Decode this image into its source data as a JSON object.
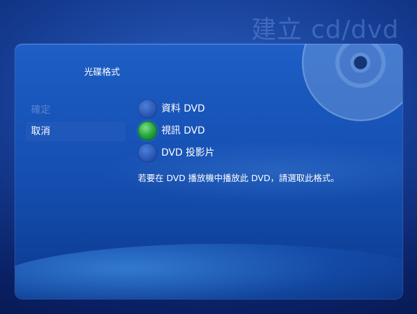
{
  "header": {
    "title": "建立 cd/dvd"
  },
  "panel": {
    "title": "光碟格式"
  },
  "menu": {
    "items": [
      {
        "label": "確定",
        "state": "disabled"
      },
      {
        "label": "取消",
        "state": "active"
      }
    ]
  },
  "options": [
    {
      "label": "資料 DVD",
      "selected": false
    },
    {
      "label": "視訊 DVD",
      "selected": true
    },
    {
      "label": "DVD 投影片",
      "selected": false
    }
  ],
  "description": "若要在 DVD 播放機中播放此 DVD，請選取此格式。",
  "colors": {
    "background": "#143a8f",
    "panel": "#1752b6",
    "radio_default": "#2a58b6",
    "radio_selected": "#22a23a",
    "text": "#ffffff",
    "disabled_text": "#8caae1"
  }
}
